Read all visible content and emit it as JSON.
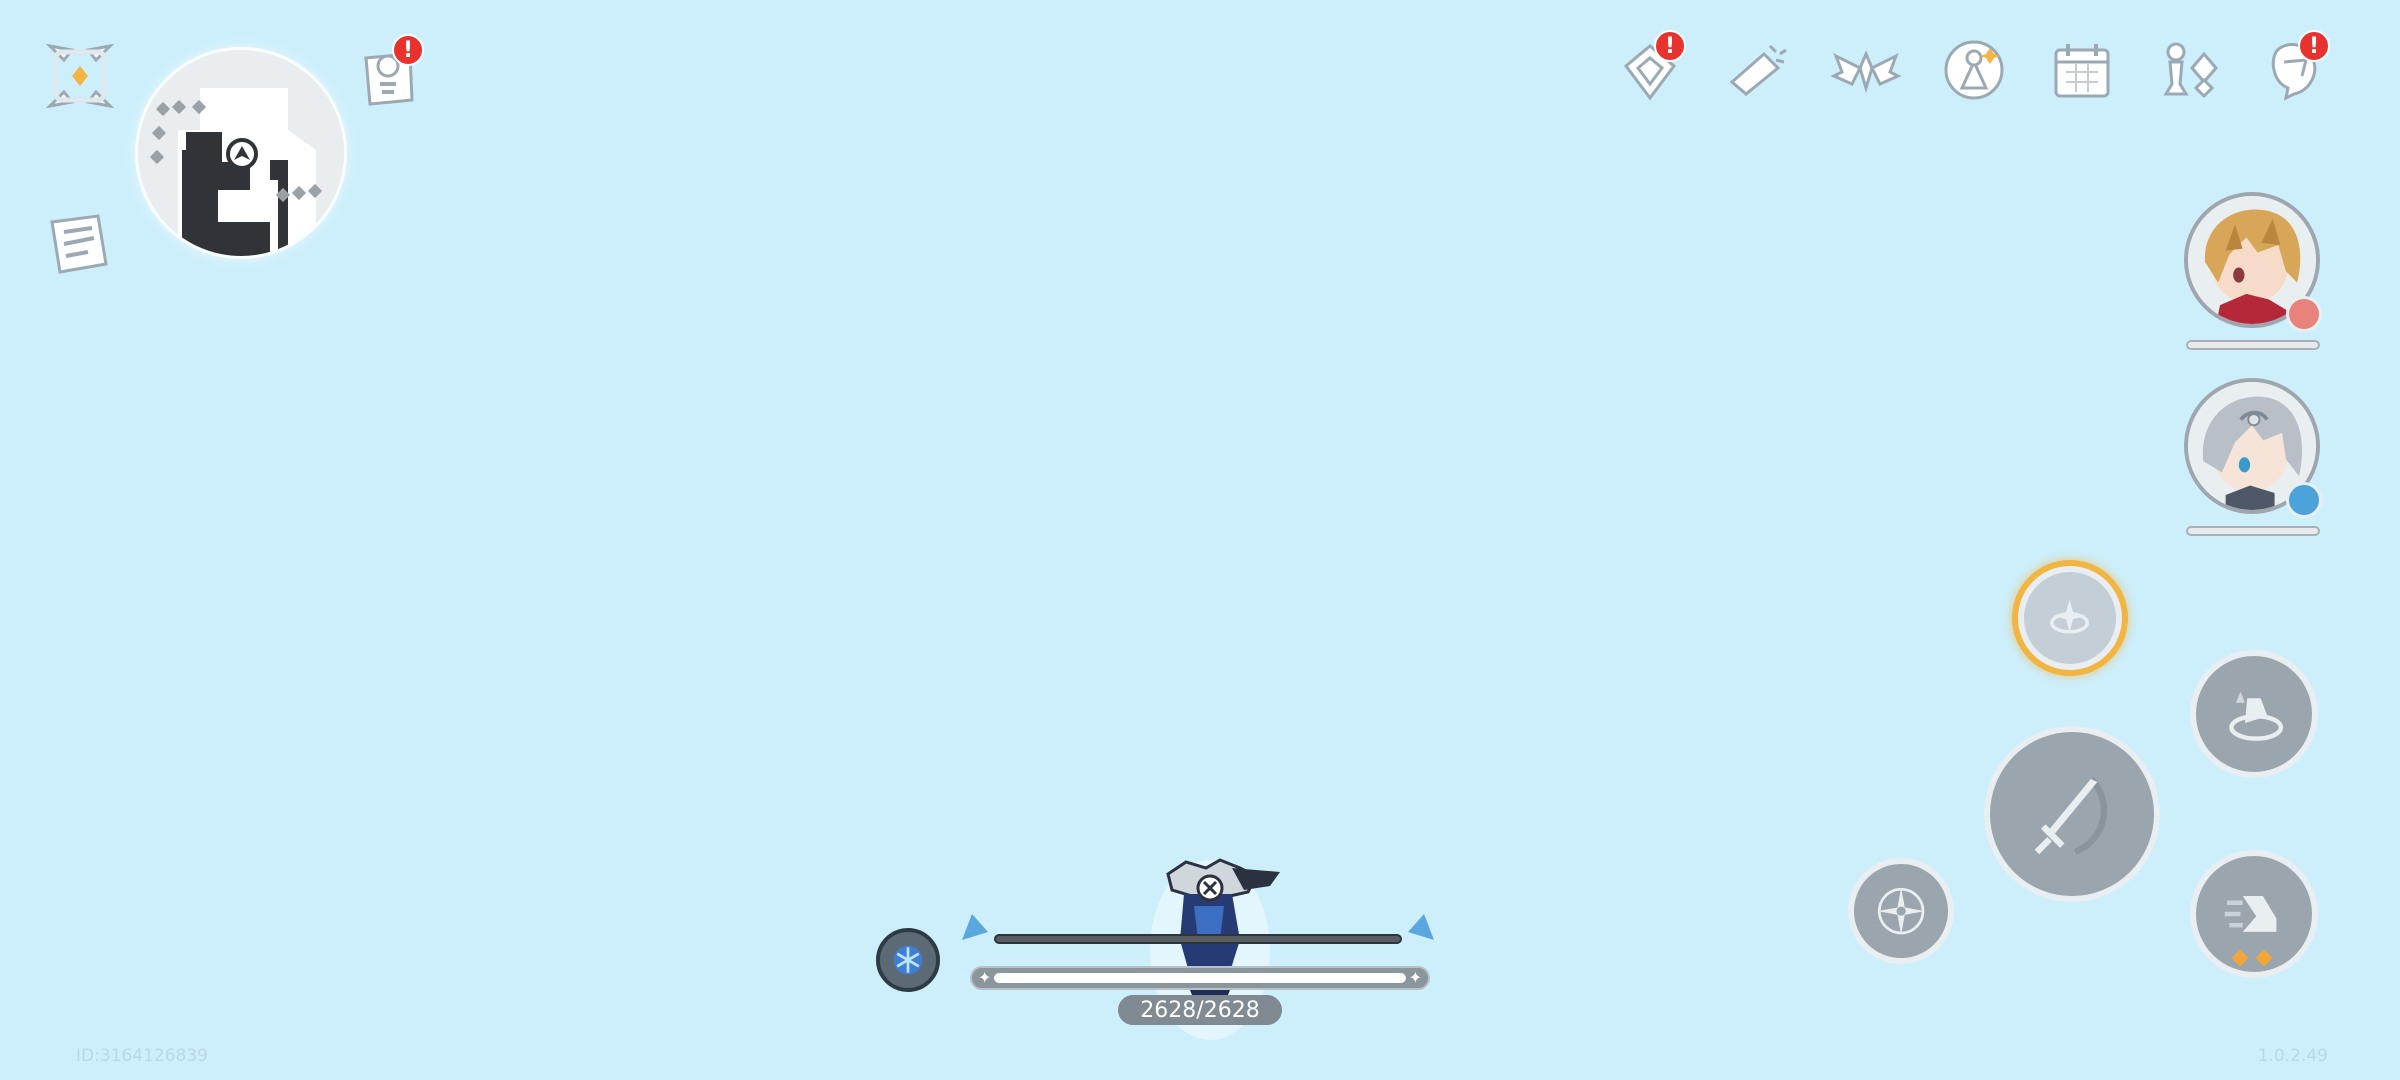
{
  "player": {
    "hp_current": 2628,
    "hp_max": 2628,
    "hp_text": "2628/2628",
    "hp_fraction": 1.0,
    "energy_fraction": 1.0
  },
  "footer": {
    "player_id": "ID:3164126839",
    "version": "1.0.2.49"
  },
  "top_left_icons": [
    "expand-menu-icon",
    "quest-log-icon",
    "notes-icon"
  ],
  "top_right_icons": [
    {
      "name": "events-icon",
      "badge": "!"
    },
    {
      "name": "trumpet-announcement-icon",
      "badge": ""
    },
    {
      "name": "wings-emblem-icon",
      "badge": ""
    },
    {
      "name": "character-radiance-icon",
      "badge": ""
    },
    {
      "name": "calendar-icon",
      "badge": ""
    },
    {
      "name": "chess-pieces-icon",
      "badge": ""
    },
    {
      "name": "character-menu-icon",
      "badge": "!"
    }
  ],
  "quest_badge": "!",
  "party": [
    {
      "name": "blonde-character-portrait",
      "element_color": "#e7837a",
      "hp_fraction": 1.0
    },
    {
      "name": "silver-hair-character-portrait",
      "element_color": "#4aa3d9",
      "hp_fraction": 1.0
    }
  ],
  "colors": {
    "background": "#cdeffc",
    "badge": "#e8322d",
    "ultimate_ring": "#f2b541",
    "button_fill": "#9aa5ad"
  },
  "skill_cooldown_fraction": 0.85
}
